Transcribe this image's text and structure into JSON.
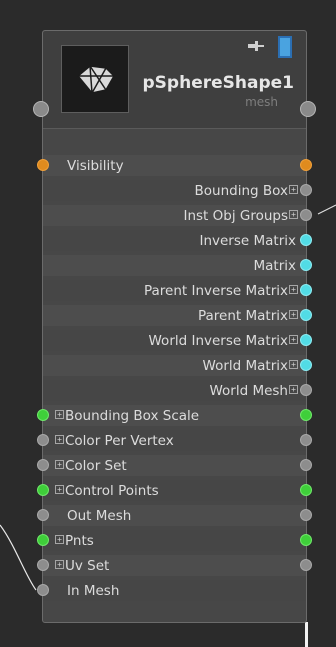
{
  "node": {
    "title": "pSphereShape1",
    "type": "mesh",
    "thumbnail_icon": "mesh-sphere-icon",
    "pin_icon": "pin-icon",
    "shape_icon": "shape-icon"
  },
  "colors": {
    "gray": "#8d8d8d",
    "orange": "#e08b1e",
    "cyan": "#52dbe5",
    "green": "#3fcf3a"
  },
  "attributes": [
    {
      "label": "Visibility",
      "align": "left",
      "expand": false,
      "in": "orange",
      "out": "orange"
    },
    {
      "label": "Bounding Box",
      "align": "right",
      "expand": true,
      "in": null,
      "out": "gray"
    },
    {
      "label": "Inst Obj Groups",
      "align": "right",
      "expand": true,
      "in": null,
      "out": "gray"
    },
    {
      "label": "Inverse Matrix",
      "align": "right",
      "expand": false,
      "in": null,
      "out": "cyan"
    },
    {
      "label": "Matrix",
      "align": "right",
      "expand": false,
      "in": null,
      "out": "cyan"
    },
    {
      "label": "Parent Inverse Matrix",
      "align": "right",
      "expand": true,
      "in": null,
      "out": "cyan"
    },
    {
      "label": "Parent Matrix",
      "align": "right",
      "expand": true,
      "in": null,
      "out": "cyan"
    },
    {
      "label": "World Inverse Matrix",
      "align": "right",
      "expand": true,
      "in": null,
      "out": "cyan"
    },
    {
      "label": "World Matrix",
      "align": "right",
      "expand": true,
      "in": null,
      "out": "cyan"
    },
    {
      "label": "World Mesh",
      "align": "right",
      "expand": true,
      "in": null,
      "out": "gray"
    },
    {
      "label": "Bounding Box Scale",
      "align": "left",
      "expand": true,
      "in": "green",
      "out": "green"
    },
    {
      "label": "Color Per Vertex",
      "align": "left",
      "expand": true,
      "in": "gray",
      "out": "gray"
    },
    {
      "label": "Color Set",
      "align": "left",
      "expand": true,
      "in": "gray",
      "out": "gray"
    },
    {
      "label": "Control Points",
      "align": "left",
      "expand": true,
      "in": "green",
      "out": "green"
    },
    {
      "label": "Out Mesh",
      "align": "left",
      "expand": false,
      "in": "gray",
      "out": "gray"
    },
    {
      "label": "Pnts",
      "align": "left",
      "expand": true,
      "in": "green",
      "out": "green"
    },
    {
      "label": "Uv Set",
      "align": "left",
      "expand": true,
      "in": "gray",
      "out": "gray"
    },
    {
      "label": "In Mesh",
      "align": "left",
      "expand": false,
      "in": "gray",
      "out": null
    }
  ]
}
